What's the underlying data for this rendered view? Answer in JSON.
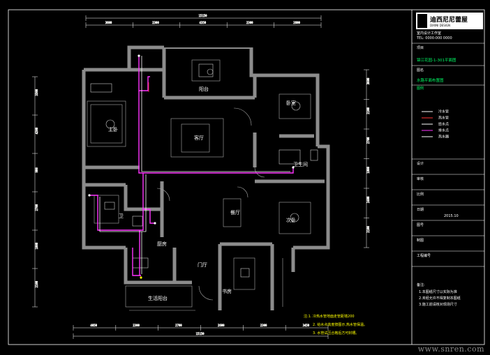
{
  "firm": {
    "logo_text": "迪西尼尼蕾屋",
    "sub": "DIXINI DESIGN",
    "line1": "室内设计工作室",
    "line2": "TEL: 0000-000 0000"
  },
  "titleblock": {
    "project_label": "项目",
    "project_value": "锦江花园-1-301平面图",
    "drawing_label": "图名",
    "drawing_value": "水路平面布置图",
    "legend_title": "图例",
    "legend": [
      {
        "name": "冷水管",
        "color": "#ffffff"
      },
      {
        "name": "热水管",
        "color": "#ff3333"
      },
      {
        "name": "给水点",
        "color": "#ffffff"
      },
      {
        "name": "排水点",
        "color": "#ff33ff"
      },
      {
        "name": "热水器",
        "color": "#ffffff"
      }
    ],
    "rows": [
      {
        "label": "设计",
        "value": ""
      },
      {
        "label": "审核",
        "value": ""
      },
      {
        "label": "比例",
        "value": ""
      },
      {
        "label": "日期",
        "value": "2015.10"
      },
      {
        "label": "图号",
        "value": ""
      },
      {
        "label": "制图",
        "value": ""
      },
      {
        "label": "工程编号",
        "value": ""
      }
    ],
    "remarks_title": "备注:",
    "remarks": [
      "1.本图纸尺寸以实际为准",
      "2.未经允许不得复制本图纸",
      "3.施工前请核对现场尺寸"
    ]
  },
  "rooms": {
    "balcony_top": "阳台",
    "master": "主卧",
    "living": "客厅",
    "bedroom2": "卧室",
    "bath2": "卫生间",
    "dining": "餐厅",
    "bedroom3": "次卧",
    "bath1": "卫",
    "kitchen": "厨房",
    "entry": "门厅",
    "study": "书房",
    "balcony_bottom": "生活阳台"
  },
  "dims_top": [
    "3600",
    "2300",
    "4350",
    "2300",
    "2600"
  ],
  "dims_top_total": "15150",
  "dims_bottom": [
    "4050",
    "2300",
    "2700",
    "2600",
    "2300",
    "3450"
  ],
  "dims_bottom_total": "15150",
  "dims_left": [
    "3300",
    "4200",
    "900",
    "2700",
    "1800",
    "2100"
  ],
  "dims_right": [
    "3600",
    "2100",
    "2700",
    "1800",
    "2400",
    "2100"
  ],
  "notes": [
    "注:1. 冷热水管地面走管距墙200",
    "2. 给水点高度按图示,热水管保温。",
    "3. 水管试压合格后方可封槽。"
  ],
  "watermark": "www.snren.com"
}
